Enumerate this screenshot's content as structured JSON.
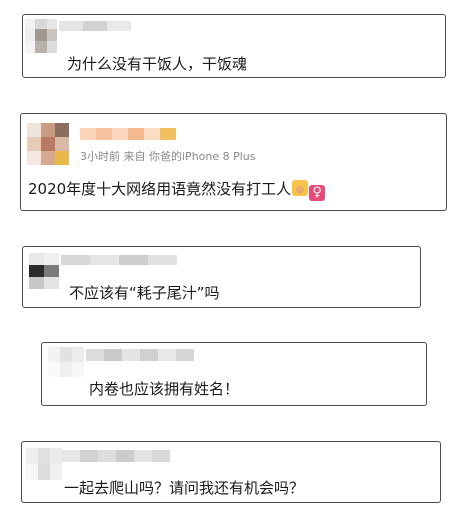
{
  "comments": [
    {
      "text": "为什么没有干饭人，干饭魂"
    },
    {
      "time": "3小时前",
      "source_prefix": "来自",
      "device": "你爸的iPhone 8 Plus",
      "text": "2020年度十大网络用语竟然没有打工人",
      "emojis": [
        "worker-emoji",
        "female-sign-emoji"
      ],
      "female_symbol": "♀"
    },
    {
      "text": "不应该有“耗子尾汁”吗"
    },
    {
      "text": "内卷也应该拥有姓名！"
    },
    {
      "text": "一起去爬山吗？请问我还有机会吗？"
    }
  ]
}
